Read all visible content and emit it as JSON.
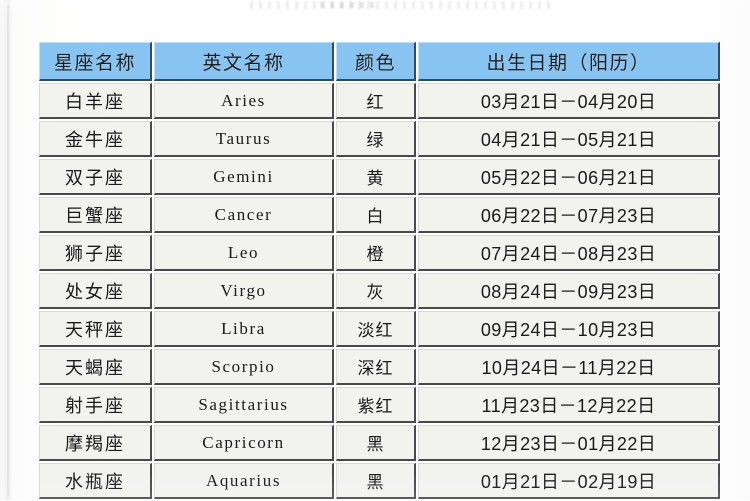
{
  "table": {
    "headers": [
      "星座名称",
      "英文名称",
      "颜色",
      "出生日期（阳历）"
    ],
    "rows": [
      {
        "cn_name": "白羊座",
        "eng_name": "Aries",
        "color": "红",
        "date_range": "03月21日－04月20日"
      },
      {
        "cn_name": "金牛座",
        "eng_name": "Taurus",
        "color": "绿",
        "date_range": "04月21日－05月21日"
      },
      {
        "cn_name": "双子座",
        "eng_name": "Gemini",
        "color": "黄",
        "date_range": "05月22日－06月21日"
      },
      {
        "cn_name": "巨蟹座",
        "eng_name": "Cancer",
        "color": "白",
        "date_range": "06月22日－07月23日"
      },
      {
        "cn_name": "狮子座",
        "eng_name": "Leo",
        "color": "橙",
        "date_range": "07月24日－08月23日"
      },
      {
        "cn_name": "处女座",
        "eng_name": "Virgo",
        "color": "灰",
        "date_range": "08月24日－09月23日"
      },
      {
        "cn_name": "天秤座",
        "eng_name": "Libra",
        "color": "淡红",
        "date_range": "09月24日－10月23日"
      },
      {
        "cn_name": "天蝎座",
        "eng_name": "Scorpio",
        "color": "深红",
        "date_range": "10月24日－11月22日"
      },
      {
        "cn_name": "射手座",
        "eng_name": "Sagittarius",
        "color": "紫红",
        "date_range": "11月23日－12月22日"
      },
      {
        "cn_name": "摩羯座",
        "eng_name": "Capricorn",
        "color": "黑",
        "date_range": "12月23日－01月22日"
      },
      {
        "cn_name": "水瓶座",
        "eng_name": "Aquarius",
        "color": "黑",
        "date_range": "01月21日－02月19日"
      }
    ]
  },
  "colors": {
    "header_background": "#88c4f2",
    "cell_background": "#f2f2ef",
    "cell_border": "#4a4a4a",
    "text": "#1a1a1a",
    "page_background": "#ffffff"
  }
}
